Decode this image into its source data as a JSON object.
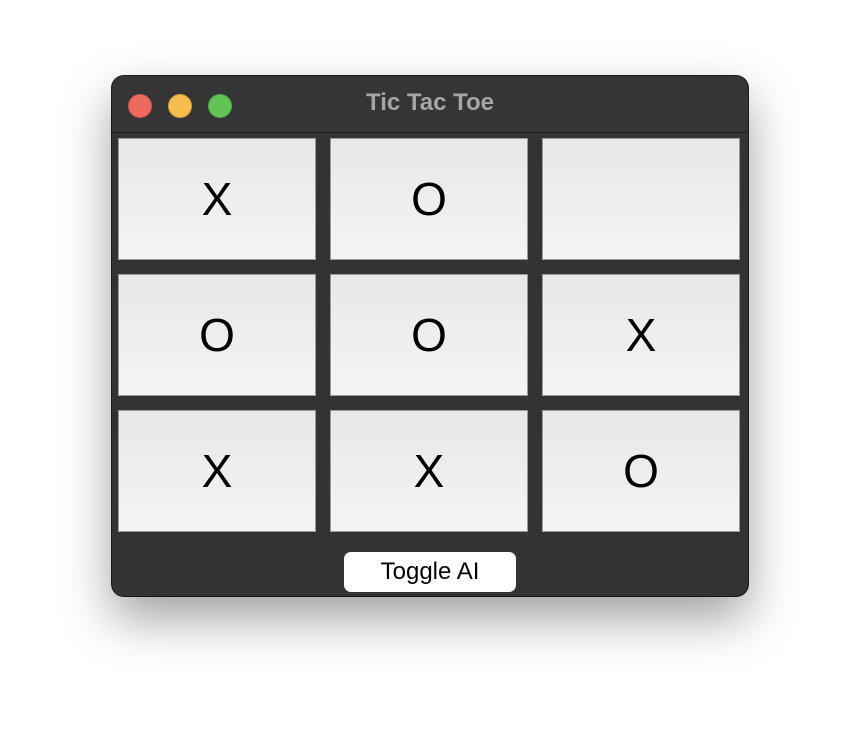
{
  "window": {
    "title": "Tic Tac Toe"
  },
  "board": {
    "cells": [
      "X",
      "O",
      "",
      "O",
      "O",
      "X",
      "X",
      "X",
      "O"
    ]
  },
  "footer": {
    "toggle_label": "Toggle AI"
  },
  "colors": {
    "window_bg": "#333333",
    "cell_bg": "#eeeeee",
    "traffic_close": "#ee6a5e",
    "traffic_minimize": "#f5bd4f",
    "traffic_zoom": "#61c454"
  }
}
